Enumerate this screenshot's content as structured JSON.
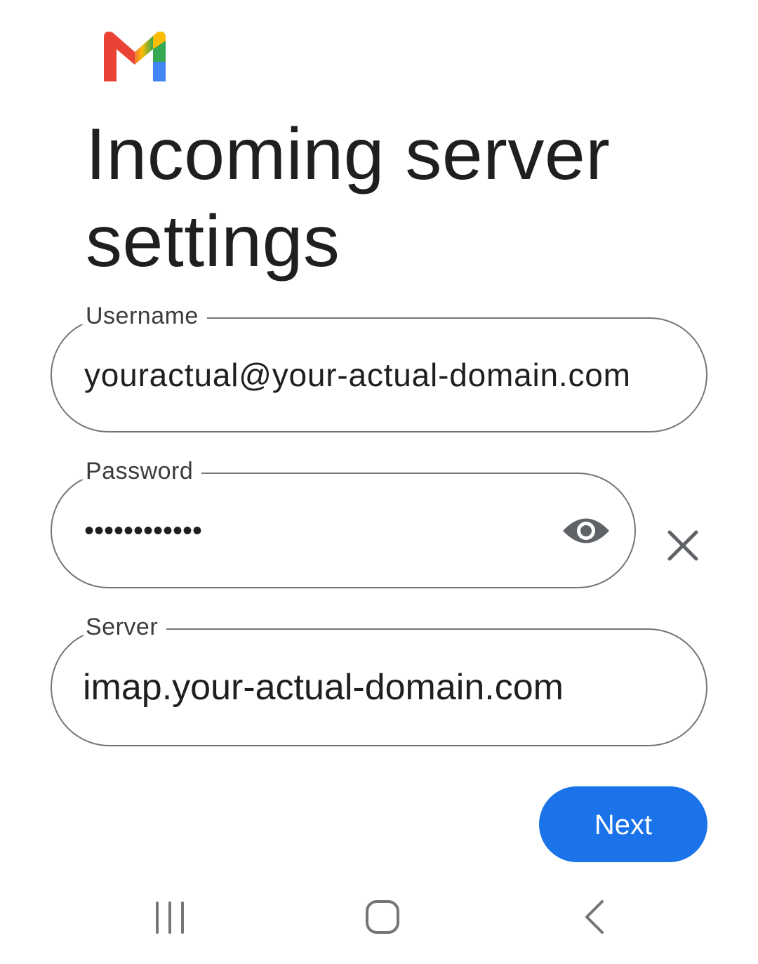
{
  "app": {
    "logo_icon": "gmail-logo-icon",
    "logo_colors": [
      "#ea4335",
      "#fbbc04",
      "#34a853",
      "#4285f4"
    ]
  },
  "page": {
    "title": "Incoming server settings"
  },
  "form": {
    "username": {
      "label": "Username",
      "value": "youractual@your-actual-domain.com"
    },
    "password": {
      "label": "Password",
      "value": "••••••••••••",
      "toggle_icon": "eye-icon",
      "clear_icon": "close-icon"
    },
    "server": {
      "label": "Server",
      "value": "imap.your-actual-domain.com"
    }
  },
  "actions": {
    "next_label": "Next",
    "accent_color": "#1a73e8"
  },
  "navbar": {
    "recents_icon": "recents-icon",
    "home_icon": "home-icon",
    "back_icon": "back-icon"
  }
}
